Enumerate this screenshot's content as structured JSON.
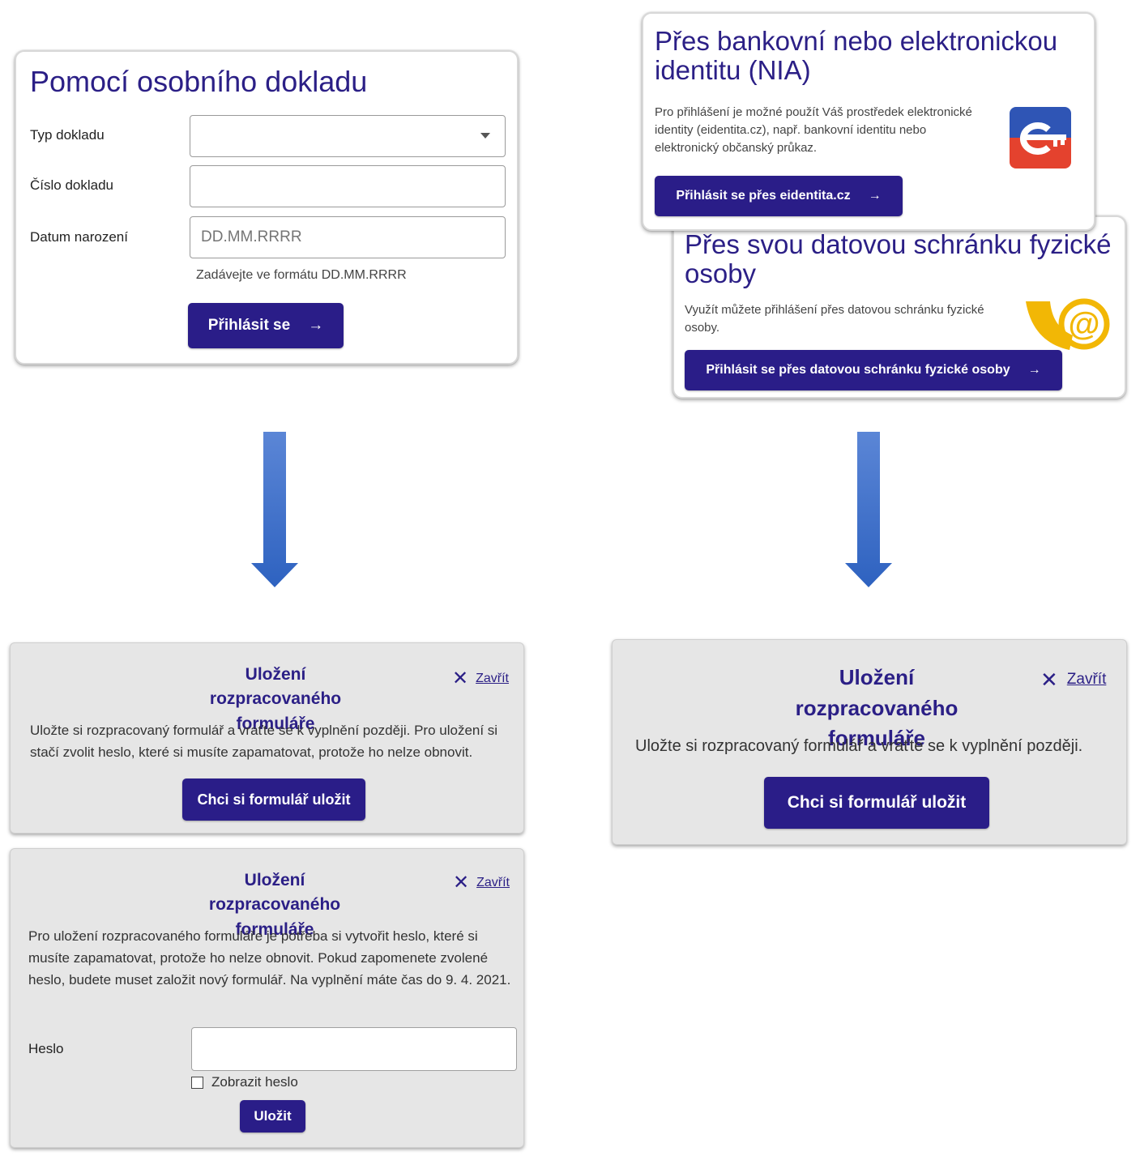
{
  "card_document": {
    "title": "Pomocí osobního dokladu",
    "fields": [
      {
        "label": "Typ dokladu",
        "value": "",
        "placeholder": ""
      },
      {
        "label": "Číslo dokladu",
        "value": "",
        "placeholder": ""
      },
      {
        "label": "Datum narození",
        "value": "",
        "placeholder": "DD.MM.RRRR"
      }
    ],
    "date_hint": "Zadávejte ve formátu DD.MM.RRRR",
    "submit_label": "Přihlásit se",
    "arrow": "→"
  },
  "card_nia": {
    "title": "Přes bankovní nebo elektronickou identitu (NIA)",
    "description": "Pro přihlášení je možné použít Váš prostředek elektronické identity (eidentita.cz), např. bankovní identitu nebo elektronický občanský průkaz.",
    "button_label": "Přihlásit se přes eidentita.cz",
    "arrow": "→",
    "logo_icon": "eidentita-logo-icon"
  },
  "card_databox": {
    "title": "Přes svou datovou schránku fyzické osoby",
    "description": "Využít můžete přihlášení přes datovou schránku fyzické osoby.",
    "button_label": "Přihlásit se přes datovou schránku fyzické osoby",
    "arrow": "→",
    "logo_icon": "datova-schranka-logo-icon"
  },
  "dialog_left_intro": {
    "title": "Uložení rozpracovaného formuláře",
    "close_label": "Zavřít",
    "text": "Uložte si rozpracovaný formulář a vraťte se k vyplnění později. Pro uložení si stačí zvolit heslo, které si musíte zapamatovat, protože ho nelze obnovit.",
    "button_label": "Chci si formulář uložit"
  },
  "dialog_left_password": {
    "title": "Uložení rozpracovaného formuláře",
    "close_label": "Zavřít",
    "text": "Pro uložení rozpracovaného formuláře je potřeba si vytvořit heslo, které si musíte zapamatovat, protože ho nelze obnovit. Pokud zapomenete zvolené heslo, budete muset založit nový formulář. Na vyplnění máte čas do 9. 4. 2021.",
    "password_label": "Heslo",
    "password_value": "",
    "show_password_label": "Zobrazit heslo",
    "show_password_checked": false,
    "save_label": "Uložit"
  },
  "dialog_right": {
    "title": "Uložení rozpracovaného formuláře",
    "close_label": "Zavřít",
    "text": "Uložte si rozpracovaný formulář a vraťte se k vyplnění později.",
    "button_label": "Chci si formulář uložit"
  },
  "colors": {
    "primary": "#2a1d88",
    "arrow": "#3a6cc4",
    "panel_bg": "#e6e6e6"
  }
}
